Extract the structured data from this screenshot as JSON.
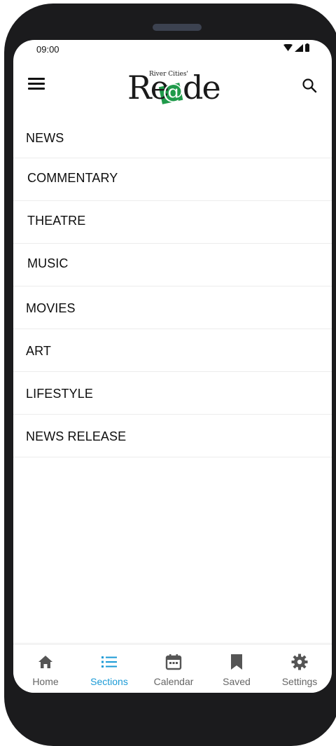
{
  "status_bar": {
    "time": "09:00"
  },
  "header": {
    "logo_small_text": "River Cities'",
    "logo_text": "Re@der"
  },
  "sections": [
    {
      "label": "NEWS"
    },
    {
      "label": "COMMENTARY"
    },
    {
      "label": "THEATRE"
    },
    {
      "label": "MUSIC"
    },
    {
      "label": "MOVIES"
    },
    {
      "label": "ART"
    },
    {
      "label": "LIFESTYLE"
    },
    {
      "label": "NEWS RELEASE"
    }
  ],
  "tabs": [
    {
      "label": "Home",
      "icon": "home-icon"
    },
    {
      "label": "Sections",
      "icon": "list-icon",
      "active": true
    },
    {
      "label": "Calendar",
      "icon": "calendar-icon"
    },
    {
      "label": "Saved",
      "icon": "bookmark-icon"
    },
    {
      "label": "Settings",
      "icon": "gear-icon"
    }
  ],
  "colors": {
    "accent": "#1a9ad6",
    "logo_green": "#1f9a4a",
    "text": "#0e0e0e"
  }
}
